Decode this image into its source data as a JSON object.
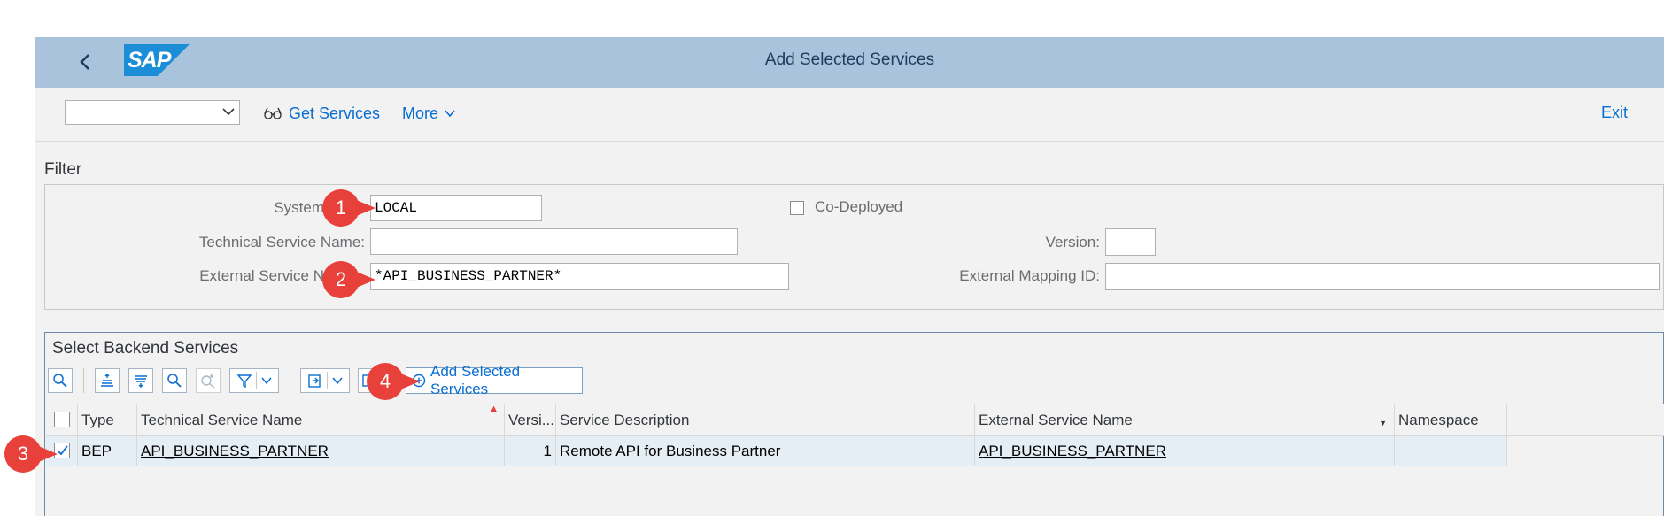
{
  "header": {
    "back_icon": "chevron-left-icon",
    "logo_text": "SAP",
    "title": "Add Selected Services",
    "colors": {
      "shellbar": "#a9c3dd",
      "logo": "#1c8dd7",
      "link": "#0a6ed1",
      "callout": "#e8413b"
    }
  },
  "toolbar": {
    "dropdown_value": "",
    "get_services_label": "Get Services",
    "more_label": "More",
    "exit_label": "Exit"
  },
  "filter": {
    "title": "Filter",
    "system_label": "System",
    "system_value": "LOCAL",
    "tech_name_label": "Technical Service Name:",
    "tech_name_value": "",
    "ext_name_label": "External Service N",
    "ext_name_value": "*API_BUSINESS_PARTNER*",
    "codeployed_label": "Co-Deployed",
    "codeployed_checked": false,
    "version_label": "Version:",
    "version_value": "",
    "ext_mapping_label": "External Mapping ID:",
    "ext_mapping_value": ""
  },
  "backend": {
    "title": "Select Backend Services",
    "add_button_label": "Add Selected Services",
    "columns": [
      "Type",
      "Technical Service Name",
      "Versi...",
      "Service Description",
      "External Service Name",
      "Namespace"
    ],
    "rows": [
      {
        "checked": true,
        "type": "BEP",
        "tech_name": "API_BUSINESS_PARTNER",
        "version": "1",
        "description": "Remote API for Business Partner",
        "ext_name": "API_BUSINESS_PARTNER",
        "namespace": ""
      }
    ]
  },
  "callouts": [
    "1",
    "2",
    "3",
    "4"
  ]
}
